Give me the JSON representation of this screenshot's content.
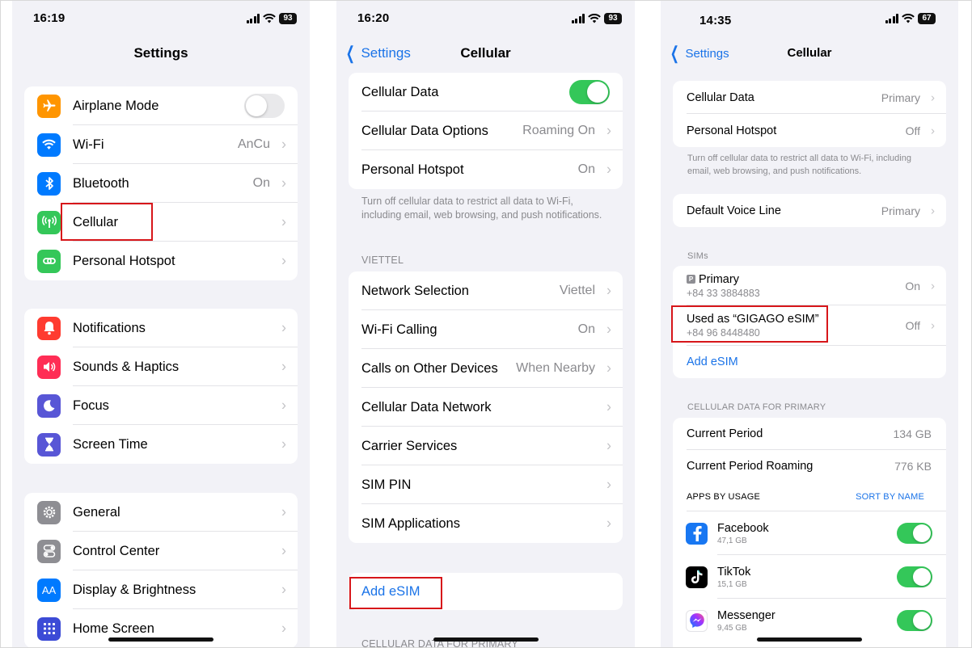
{
  "panel1": {
    "status": {
      "time": "16:19",
      "battery": "93"
    },
    "title": "Settings",
    "group1": [
      {
        "label": "Airplane Mode",
        "icon": "airplane-icon",
        "color": "#ff9500"
      },
      {
        "label": "Wi-Fi",
        "value": "AnCu",
        "icon": "wifi-icon",
        "color": "#007aff"
      },
      {
        "label": "Bluetooth",
        "value": "On",
        "icon": "bluetooth-icon",
        "color": "#007aff"
      },
      {
        "label": "Cellular",
        "icon": "antenna-icon",
        "color": "#34c759"
      },
      {
        "label": "Personal Hotspot",
        "icon": "hotspot-icon",
        "color": "#34c759"
      }
    ],
    "group2": [
      {
        "label": "Notifications",
        "icon": "bell-icon",
        "color": "#ff3b30"
      },
      {
        "label": "Sounds & Haptics",
        "icon": "speaker-icon",
        "color": "#ff2d55"
      },
      {
        "label": "Focus",
        "icon": "moon-icon",
        "color": "#5856d6"
      },
      {
        "label": "Screen Time",
        "icon": "hourglass-icon",
        "color": "#5856d6"
      }
    ],
    "group3": [
      {
        "label": "General",
        "icon": "gear-icon",
        "color": "#8e8e93"
      },
      {
        "label": "Control Center",
        "icon": "switches-icon",
        "color": "#8e8e93"
      },
      {
        "label": "Display & Brightness",
        "icon": "text-size-icon",
        "color": "#007aff",
        "glyph": "AA"
      },
      {
        "label": "Home Screen",
        "icon": "app-grid-icon",
        "color": "#3c4bd6"
      }
    ]
  },
  "panel2": {
    "status": {
      "time": "16:20",
      "battery": "93"
    },
    "back_label": "Settings",
    "title": "Cellular",
    "group1": [
      {
        "label": "Cellular Data"
      },
      {
        "label": "Cellular Data Options",
        "value": "Roaming On"
      },
      {
        "label": "Personal Hotspot",
        "value": "On"
      }
    ],
    "note": "Turn off cellular data to restrict all data to Wi-Fi, including email, web browsing, and push notifications.",
    "section_viettel": "VIETTEL",
    "group2": [
      {
        "label": "Network Selection",
        "value": "Viettel"
      },
      {
        "label": "Wi-Fi Calling",
        "value": "On"
      },
      {
        "label": "Calls on Other Devices",
        "value": "When Nearby"
      },
      {
        "label": "Cellular Data Network"
      },
      {
        "label": "Carrier Services"
      },
      {
        "label": "SIM PIN"
      },
      {
        "label": "SIM Applications"
      }
    ],
    "add_esim": "Add eSIM",
    "section_cellular_primary": "CELLULAR DATA FOR PRIMARY"
  },
  "panel3": {
    "status": {
      "time": "14:35",
      "battery": "67"
    },
    "back_label": "Settings",
    "title": "Cellular",
    "group1": [
      {
        "label": "Cellular Data",
        "value": "Primary"
      },
      {
        "label": "Personal Hotspot",
        "value": "Off"
      }
    ],
    "note": "Turn off cellular data to restrict all data to Wi-Fi, including email, web browsing, and push notifications.",
    "default_voice": {
      "label": "Default Voice Line",
      "value": "Primary"
    },
    "section_sims": "SIMs",
    "sims": [
      {
        "badge": "P",
        "label": "Primary",
        "number": "+84 33 3884883",
        "value": "On"
      },
      {
        "label": "Used as “GIGAGO eSIM”",
        "number": "+84 96 8448480",
        "value": "Off"
      }
    ],
    "add_esim": "Add eSIM",
    "section_cellular_primary": "CELLULAR DATA FOR PRIMARY",
    "usage": [
      {
        "label": "Current Period",
        "value": "134 GB"
      },
      {
        "label": "Current Period Roaming",
        "value": "776 KB"
      }
    ],
    "apps_by_usage": "APPS BY USAGE",
    "sort_by_name": "SORT BY NAME",
    "apps": [
      {
        "name": "Facebook",
        "size": "47,1 GB",
        "icon": "facebook-icon"
      },
      {
        "name": "TikTok",
        "size": "15,1 GB",
        "icon": "tiktok-icon"
      },
      {
        "name": "Messenger",
        "size": "9,45 GB",
        "icon": "messenger-icon"
      }
    ]
  }
}
